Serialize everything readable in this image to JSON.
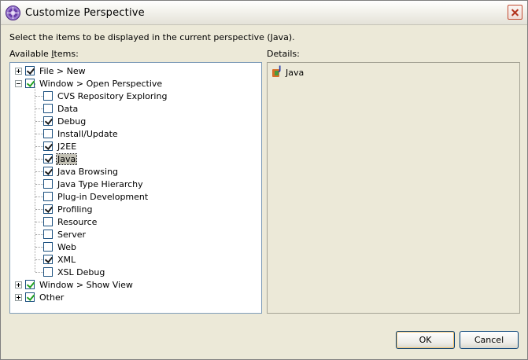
{
  "window": {
    "title": "Customize Perspective"
  },
  "instructions": "Select the items to be displayed in the current perspective (Java).",
  "available_label_prefix": "Available ",
  "available_label_mnemonic": "I",
  "available_label_suffix": "tems:",
  "details_label": "Details:",
  "tree": {
    "file_new": {
      "label": "File > New",
      "checked": true
    },
    "open_perspective": {
      "label": "Window > Open Perspective",
      "checked": true,
      "children": [
        {
          "label": "CVS Repository Exploring",
          "checked": false
        },
        {
          "label": "Data",
          "checked": false
        },
        {
          "label": "Debug",
          "checked": true
        },
        {
          "label": "Install/Update",
          "checked": false
        },
        {
          "label": "J2EE",
          "checked": true
        },
        {
          "label": "Java",
          "checked": true,
          "selected": true
        },
        {
          "label": "Java Browsing",
          "checked": true
        },
        {
          "label": "Java Type Hierarchy",
          "checked": false
        },
        {
          "label": "Plug-in Development",
          "checked": false
        },
        {
          "label": "Profiling",
          "checked": true
        },
        {
          "label": "Resource",
          "checked": false
        },
        {
          "label": "Server",
          "checked": false
        },
        {
          "label": "Web",
          "checked": false
        },
        {
          "label": "XML",
          "checked": true
        },
        {
          "label": "XSL Debug",
          "checked": false
        }
      ]
    },
    "show_view": {
      "label": "Window > Show View",
      "checked": true
    },
    "other": {
      "label": "Other",
      "checked": true
    }
  },
  "details": {
    "item_label": "Java",
    "item_icon": "java-perspective-icon"
  },
  "buttons": {
    "ok": "OK",
    "cancel": "Cancel"
  },
  "colors": {
    "check_green": "#21a121",
    "title_bar": "#f3f2ec",
    "dialog_bg": "#ece9d8"
  }
}
